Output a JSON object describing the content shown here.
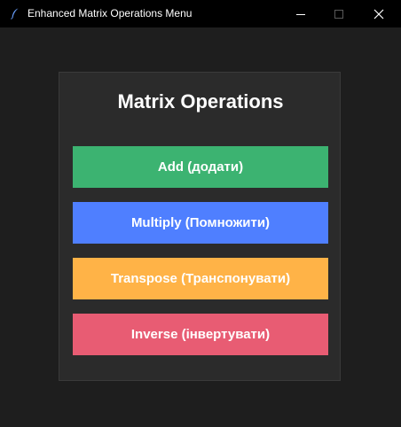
{
  "window": {
    "title": "Enhanced Matrix Operations Menu",
    "controls": {
      "minimize_icon": "minimize-icon",
      "maximize_icon": "maximize-icon",
      "close_icon": "close-icon"
    }
  },
  "main": {
    "heading": "Matrix Operations",
    "buttons": [
      {
        "label": "Add (додати)",
        "color": "#3cb371"
      },
      {
        "label": "Multiply (Помножити)",
        "color": "#4f7fff"
      },
      {
        "label": "Transpose (Транспонувати)",
        "color": "#ffb347"
      },
      {
        "label": "Inverse (інвертувати)",
        "color": "#e85c73"
      }
    ]
  },
  "colors": {
    "background": "#1e1e1e",
    "panel": "#2b2b2b",
    "titlebar": "#000000"
  }
}
